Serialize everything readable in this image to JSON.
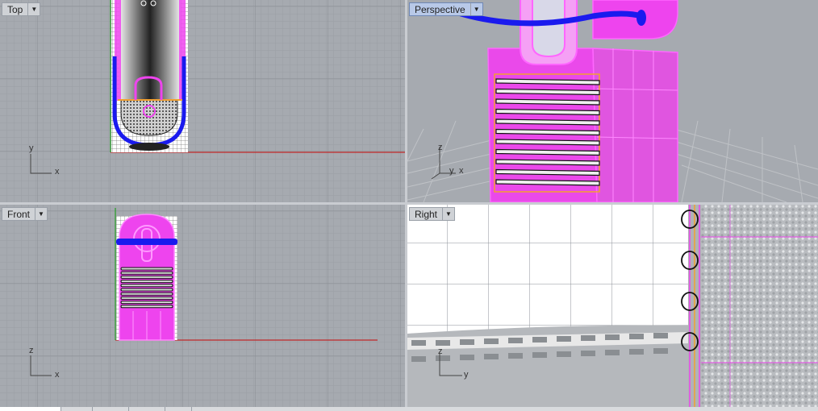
{
  "viewports": {
    "top": {
      "label": "Top",
      "axis_a": "y",
      "axis_b": "x"
    },
    "perspective": {
      "label": "Perspective",
      "axis_a": "z",
      "axis_b": "y",
      "axis_c": "x"
    },
    "front": {
      "label": "Front",
      "axis_a": "z",
      "axis_b": "x"
    },
    "right": {
      "label": "Right",
      "axis_a": "z",
      "axis_b": "y"
    }
  },
  "icons": {
    "viewport_menu": "chevron-down-icon"
  },
  "colors": {
    "grid_bg": "#a6aab0",
    "grid_line": "#9a9ea4",
    "grid_major": "#8e9298",
    "selected": "#ee44ee",
    "blue_curve": "#1a1aee",
    "x_axis": "#c02828",
    "y_axis": "#28a028"
  }
}
